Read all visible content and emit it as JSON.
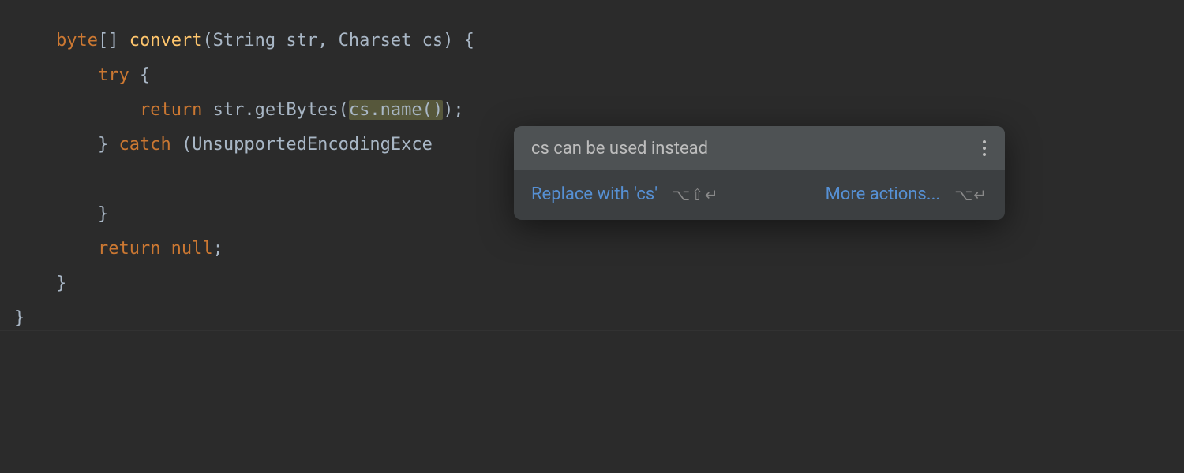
{
  "code": {
    "line1": {
      "kw_byte": "byte",
      "brackets": "[] ",
      "method": "convert",
      "params": "(String str, Charset cs) {"
    },
    "line2": {
      "indent": "    ",
      "kw_try": "try",
      "brace": " {"
    },
    "line3": {
      "indent": "        ",
      "kw_return": "return",
      "call1": " str.getBytes(",
      "highlighted": "cs.name()",
      "call2": ");"
    },
    "line4": {
      "indent": "    ",
      "brace_close": "} ",
      "kw_catch": "catch",
      "params": " (UnsupportedEncodingExce"
    },
    "line5": "",
    "line6": {
      "indent": "    ",
      "brace": "}"
    },
    "line7": {
      "indent": "    ",
      "kw_return": "return null",
      "semi": ";"
    },
    "line8": {
      "indent": "",
      "brace": "}"
    },
    "line9": {
      "brace": "}"
    }
  },
  "popup": {
    "title": "cs can be used instead",
    "replace_action": "Replace with 'cs'",
    "replace_shortcut": "⌥⇧↵",
    "more_actions": "More actions...",
    "more_shortcut": "⌥↵"
  }
}
